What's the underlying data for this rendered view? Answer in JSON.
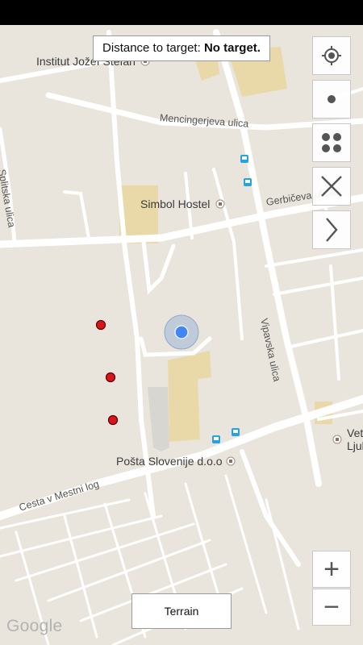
{
  "distance": {
    "prefix": "Distance to target: ",
    "value": "No target."
  },
  "places": {
    "institut": "Institut Jožef Stefan",
    "hostel": "Simbol Hostel",
    "posta": "Pošta Slovenije d.o.o",
    "vet": "Vet",
    "vet2": "Ljub"
  },
  "streets": {
    "mencinger": "Mencingerjeva ulica",
    "gerbiceva": "Gerbičeva ulica",
    "splitska": "Splitska ulica",
    "vipavska": "Vipavska ulica",
    "mestni_log": "Cesta v Mestni log"
  },
  "controls": {
    "locate": "my-location-icon",
    "single_point": "dot-icon",
    "multi_point": "four-dots-icon",
    "clear": "close-icon",
    "next": "chevron-right-icon",
    "zoom_in": "+",
    "zoom_out": "−"
  },
  "map_type_button": "Terrain",
  "logo": "Google",
  "colors": {
    "marker": "#d9141a",
    "location": "#4285f4",
    "transit": "#21a4e0"
  }
}
